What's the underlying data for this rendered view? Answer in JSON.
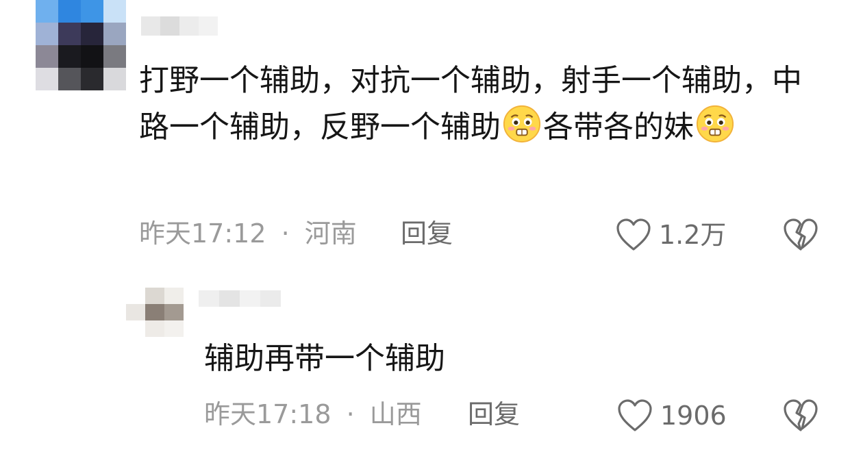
{
  "comments": [
    {
      "text_parts": [
        "打野一个辅助，对抗一个辅助，射手一个辅助，中路一个辅助，反野一个辅助",
        "各带各的妹",
        ""
      ],
      "emoji": "worried-face-emoji",
      "time": "昨天17:12",
      "separator": "·",
      "location": "河南",
      "reply_label": "回复",
      "likes": "1.2万"
    },
    {
      "text": "辅助再带一个辅助",
      "time": "昨天17:18",
      "separator": "·",
      "location": "山西",
      "reply_label": "回复",
      "likes": "1906"
    }
  ],
  "icons": {
    "like": "heart-outline-icon",
    "dislike": "broken-heart-icon"
  },
  "colors": {
    "text": "#161616",
    "meta": "#9a9a9a",
    "action": "#6b6b6b"
  }
}
